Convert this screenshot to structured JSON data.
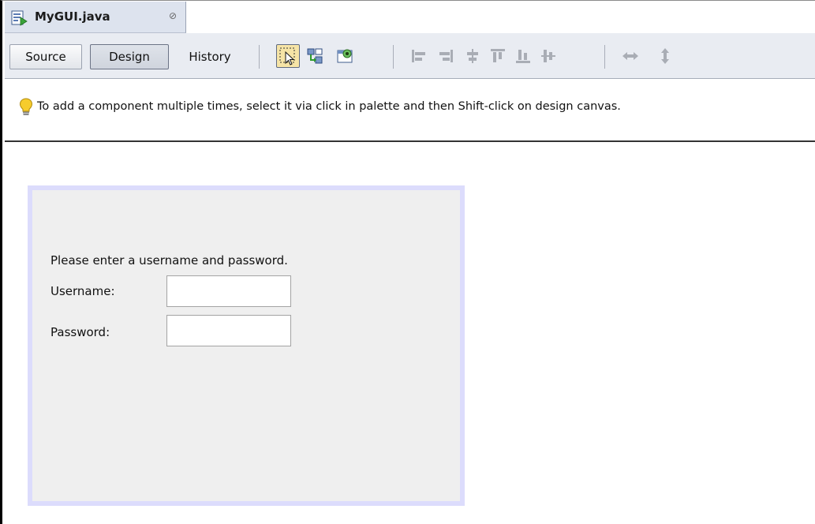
{
  "editor_tab": {
    "title": "MyGUI.java",
    "file_icon": "java-form-file-icon",
    "close_icon": "close-icon",
    "close_glyph": "⊘"
  },
  "toolbar": {
    "source_label": "Source",
    "design_label": "Design",
    "history_label": "History",
    "active_view": "Design",
    "tools": [
      "selection-mode-icon",
      "connection-mode-icon",
      "preview-design-icon",
      "align-left-icon",
      "align-right-icon",
      "center-horizontally-icon",
      "align-top-icon",
      "align-bottom-icon",
      "center-vertically-icon",
      "change-horizontal-resizability-icon",
      "change-vertical-resizability-icon"
    ]
  },
  "hint": {
    "icon": "lightbulb-icon",
    "text": "To add a component multiple times, select it via click in palette and then Shift-click on design canvas."
  },
  "form": {
    "prompt": "Please enter a username and password.",
    "username_label": "Username:",
    "username_value": "",
    "password_label": "Password:",
    "password_value": ""
  },
  "colors": {
    "toolbar_bg": "#e9ecf2",
    "tab_bg": "#dde3ee",
    "form_outline": "#dcdcfc",
    "form_bg": "#efefef",
    "selected_tool_bg": "#f6e4a6",
    "hint_bulb": "#f2c21b"
  }
}
